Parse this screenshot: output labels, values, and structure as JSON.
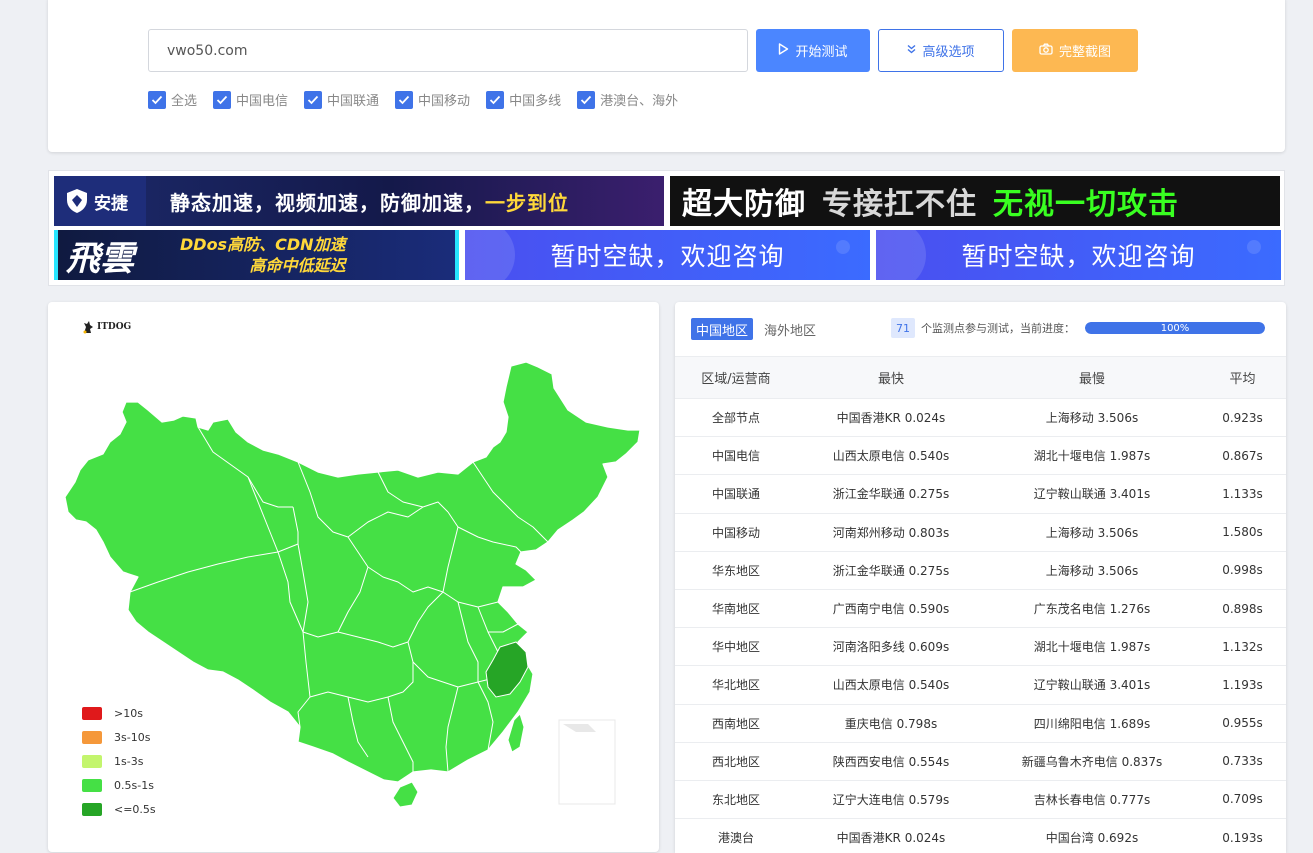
{
  "search": {
    "value": "vwo50.com",
    "start_label": "开始测试",
    "advanced_label": "高级选项",
    "screenshot_label": "完整截图"
  },
  "filters": [
    {
      "label": "全选",
      "checked": true
    },
    {
      "label": "中国电信",
      "checked": true
    },
    {
      "label": "中国联通",
      "checked": true
    },
    {
      "label": "中国移动",
      "checked": true
    },
    {
      "label": "中国多线",
      "checked": true
    },
    {
      "label": "港澳台、海外",
      "checked": true
    }
  ],
  "ads": {
    "ad1": {
      "logo": "安捷",
      "text": "静态加速，视频加速，防御加速，",
      "highlight": "一步到位"
    },
    "ad2": {
      "part1": "超大防御",
      "part2": "专接扛不住",
      "part3": "无视一切攻击"
    },
    "ad3": {
      "brand": "飛雲",
      "line1": "DDos高防、CDN加速",
      "line2": "高命中低延迟"
    },
    "ad4": {
      "text": "暂时空缺，欢迎咨询"
    },
    "ad5": {
      "text": "暂时空缺，欢迎咨询"
    }
  },
  "map": {
    "watermark": "ITDOG",
    "legend": [
      {
        "label": ">10s",
        "color": "#e0191b"
      },
      {
        "label": "3s-10s",
        "color": "#f5983a"
      },
      {
        "label": "1s-3s",
        "color": "#c3f56d"
      },
      {
        "label": "0.5s-1s",
        "color": "#45e045"
      },
      {
        "label": "<=0.5s",
        "color": "#26a526"
      }
    ]
  },
  "results": {
    "tabs": [
      "中国地区",
      "海外地区"
    ],
    "node_count": "71",
    "info_text": "个监测点参与测试，当前进度：",
    "progress": 100,
    "progress_label": "100%",
    "columns": [
      "区域/运营商",
      "最快",
      "最慢",
      "平均"
    ],
    "rows": [
      [
        "全部节点",
        "中国香港KR 0.024s",
        "上海移动 3.506s",
        "0.923s"
      ],
      [
        "中国电信",
        "山西太原电信 0.540s",
        "湖北十堰电信 1.987s",
        "0.867s"
      ],
      [
        "中国联通",
        "浙江金华联通 0.275s",
        "辽宁鞍山联通 3.401s",
        "1.133s"
      ],
      [
        "中国移动",
        "河南郑州移动 0.803s",
        "上海移动 3.506s",
        "1.580s"
      ],
      [
        "华东地区",
        "浙江金华联通 0.275s",
        "上海移动 3.506s",
        "0.998s"
      ],
      [
        "华南地区",
        "广西南宁电信 0.590s",
        "广东茂名电信 1.276s",
        "0.898s"
      ],
      [
        "华中地区",
        "河南洛阳多线 0.609s",
        "湖北十堰电信 1.987s",
        "1.132s"
      ],
      [
        "华北地区",
        "山西太原电信 0.540s",
        "辽宁鞍山联通 3.401s",
        "1.193s"
      ],
      [
        "西南地区",
        "重庆电信 0.798s",
        "四川绵阳电信 1.689s",
        "0.955s"
      ],
      [
        "西北地区",
        "陕西西安电信 0.554s",
        "新疆乌鲁木齐电信 0.837s",
        "0.733s"
      ],
      [
        "东北地区",
        "辽宁大连电信 0.579s",
        "吉林长春电信 0.777s",
        "0.709s"
      ],
      [
        "港澳台",
        "中国香港KR 0.024s",
        "中国台湾 0.692s",
        "0.193s"
      ]
    ]
  }
}
